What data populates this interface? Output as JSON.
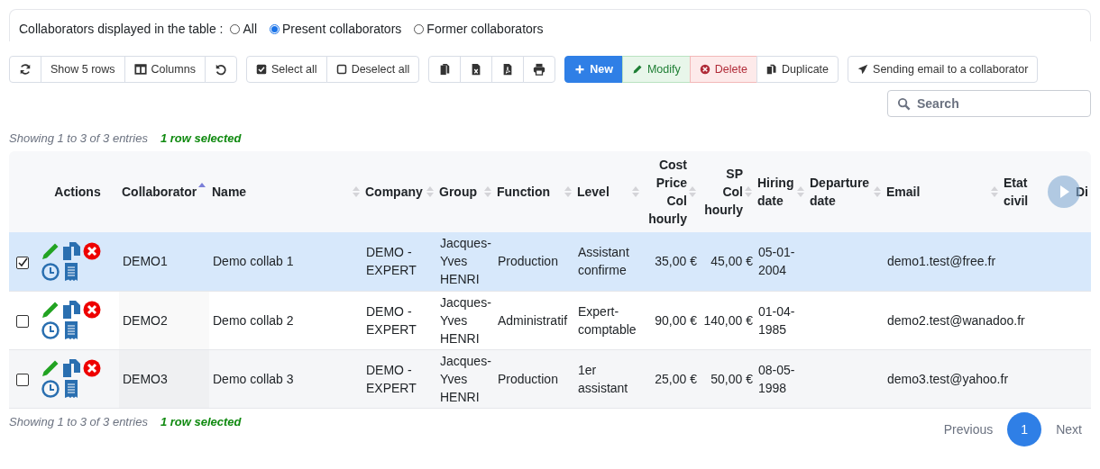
{
  "filter": {
    "label": "Collaborators displayed in the table :",
    "options": [
      {
        "label": "All",
        "selected": false
      },
      {
        "label": "Present collaborators",
        "selected": true
      },
      {
        "label": "Former collaborators",
        "selected": false
      }
    ]
  },
  "toolbar": {
    "show_rows": "Show 5 rows",
    "columns": "Columns",
    "select_all": "Select all",
    "deselect_all": "Deselect all",
    "new": "New",
    "modify": "Modify",
    "delete": "Delete",
    "duplicate": "Duplicate",
    "send_email": "Sending email to a collaborator"
  },
  "search": {
    "placeholder": "Search"
  },
  "info_top": {
    "entries": "Showing 1 to 3 of 3 entries",
    "selection": "1 row selected"
  },
  "table": {
    "actions_header": "Actions",
    "columns": [
      {
        "label": "Collaborator",
        "kind": "text",
        "sorted": true
      },
      {
        "label": "Name",
        "kind": "text",
        "sorted": false
      },
      {
        "label": "Company",
        "kind": "text",
        "sorted": false
      },
      {
        "label": "Group",
        "kind": "text",
        "sorted": false
      },
      {
        "label": "Function",
        "kind": "text",
        "sorted": false
      },
      {
        "label": "Level",
        "kind": "text",
        "sorted": false
      },
      {
        "label": "Cost Price Col hourly",
        "kind": "amount",
        "sorted": false
      },
      {
        "label": "SP Col hourly",
        "kind": "amount",
        "sorted": false
      },
      {
        "label": "Hiring date",
        "kind": "text",
        "sorted": false
      },
      {
        "label": "Departure date",
        "kind": "text",
        "sorted": false
      },
      {
        "label": "Email",
        "kind": "text",
        "sorted": false
      },
      {
        "label": "Etat civil",
        "kind": "text"
      },
      {
        "label": "Di",
        "kind": "text"
      }
    ],
    "rows": [
      {
        "selected": true,
        "cells": [
          "DEMO1",
          "Demo collab 1",
          "DEMO - EXPERT",
          "Jacques-Yves HENRI",
          "Production",
          "Assistant confirme",
          "35,00 €",
          "45,00 €",
          "05-01-2004",
          "",
          "demo1.test@free.fr",
          "",
          ""
        ]
      },
      {
        "selected": false,
        "cells": [
          "DEMO2",
          "Demo collab 2",
          "DEMO - EXPERT",
          "Jacques-Yves HENRI",
          "Administratif",
          "Expert-comptable",
          "90,00 €",
          "140,00 €",
          "01-04-1985",
          "",
          "demo2.test@wanadoo.fr",
          "",
          ""
        ]
      },
      {
        "selected": false,
        "cells": [
          "DEMO3",
          "Demo collab 3",
          "DEMO - EXPERT",
          "Jacques-Yves HENRI",
          "Production",
          "1er assistant",
          "25,00 €",
          "50,00 €",
          "08-05-1998",
          "",
          "demo3.test@yahoo.fr",
          "",
          ""
        ]
      }
    ]
  },
  "info_bottom": {
    "entries": "Showing 1 to 3 of 3 entries",
    "selection": "1 row selected"
  },
  "pagination": {
    "previous": "Previous",
    "pages": [
      {
        "label": "1",
        "selected": true
      }
    ],
    "next": "Next"
  }
}
